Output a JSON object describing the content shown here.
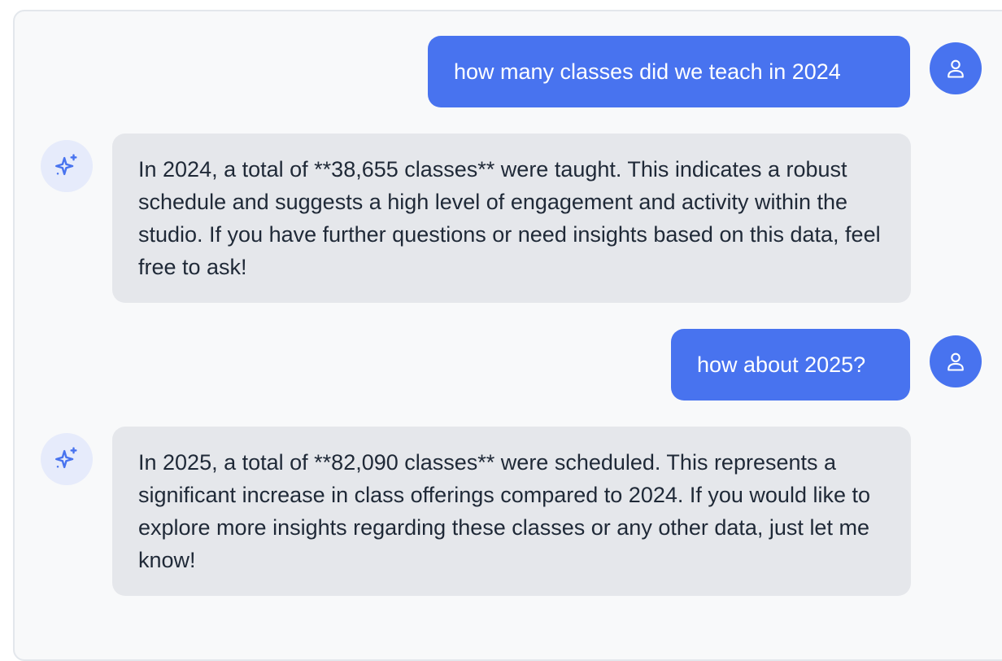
{
  "colors": {
    "user_bubble": "#4873ef",
    "ai_bubble": "#e5e7eb",
    "ai_avatar_bg": "#e6ebfb",
    "panel_bg": "#f8f9fa"
  },
  "conversation": {
    "messages": [
      {
        "role": "user",
        "icon": "user-icon",
        "text": "how many classes did we teach in 2024"
      },
      {
        "role": "assistant",
        "icon": "sparkle-icon",
        "text": "In 2024, a total of **38,655 classes** were taught. This indicates a robust schedule and suggests a high level of engagement and activity within the studio. If you have further questions or need insights based on this data, feel free to ask!"
      },
      {
        "role": "user",
        "icon": "user-icon",
        "text": "how about 2025?"
      },
      {
        "role": "assistant",
        "icon": "sparkle-icon",
        "text": "In 2025, a total of **82,090 classes** were scheduled. This represents a significant increase in class offerings compared to 2024. If you would like to explore more insights regarding these classes or any other data, just let me know!"
      }
    ]
  }
}
